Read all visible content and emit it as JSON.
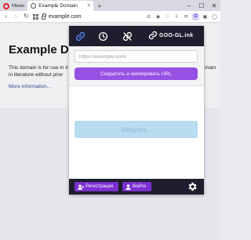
{
  "browser": {
    "menu_label": "Меню",
    "tab_title": "Example Domain",
    "new_tab_label": "+",
    "address": "example.com",
    "window_controls": [
      "minimize-icon",
      "maximize-icon",
      "close-icon"
    ]
  },
  "page": {
    "title": "Example Domain",
    "title_visible": "Example Do",
    "paragraph": "This domain is for use in il",
    "paragraph_line2": "in literature without prior",
    "paragraph_right": "main",
    "link": "More information..."
  },
  "popup": {
    "brand": "GOO-GL.ink",
    "nav_icons": [
      "link-icon",
      "clock-icon",
      "link-icon",
      "brand-link-icon"
    ],
    "url_placeholder": "https://example.com/",
    "shorten_button": "Сократить и скопировать URL",
    "loading_text": "Загрузка...",
    "register_button": "Регистрация",
    "login_button": "Войти",
    "settings_icon": "gear-icon",
    "colors": {
      "header_bg": "#1e1e2e",
      "accent": "#9650e3",
      "footer_button": "#7a2fd0",
      "active_icon": "#5b8cff",
      "loading_bg": "#b8dcf0"
    }
  }
}
